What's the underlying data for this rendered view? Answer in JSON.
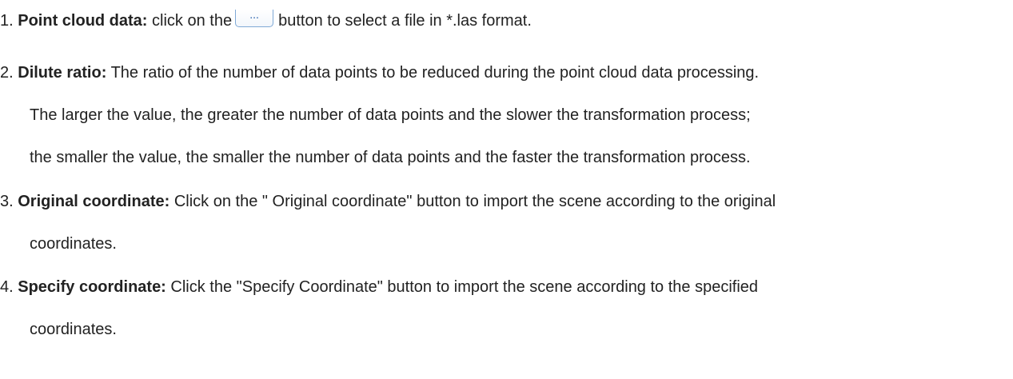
{
  "items": [
    {
      "num": "1.",
      "term": "Point cloud data:",
      "text_before_button": "click on the",
      "button_label": "...",
      "text_after_button": "button to select a file in *.las format."
    },
    {
      "num": "2.",
      "term": "Dilute ratio:",
      "lines": [
        "The ratio of the number of data points to be reduced during the point cloud data processing.",
        "The larger the value, the greater the number of data points and the slower the transformation process;",
        "the smaller the value, the smaller the number of data points and the faster the transformation process."
      ]
    },
    {
      "num": "3.",
      "term": "Original coordinate:",
      "lines": [
        "Click on the \" Original coordinate\" button to import the scene according to the original",
        "coordinates."
      ]
    },
    {
      "num": "4.",
      "term": "Specify coordinate:",
      "lines": [
        "Click the \"Specify Coordinate\" button to import the scene according to the specified",
        "coordinates."
      ]
    }
  ]
}
